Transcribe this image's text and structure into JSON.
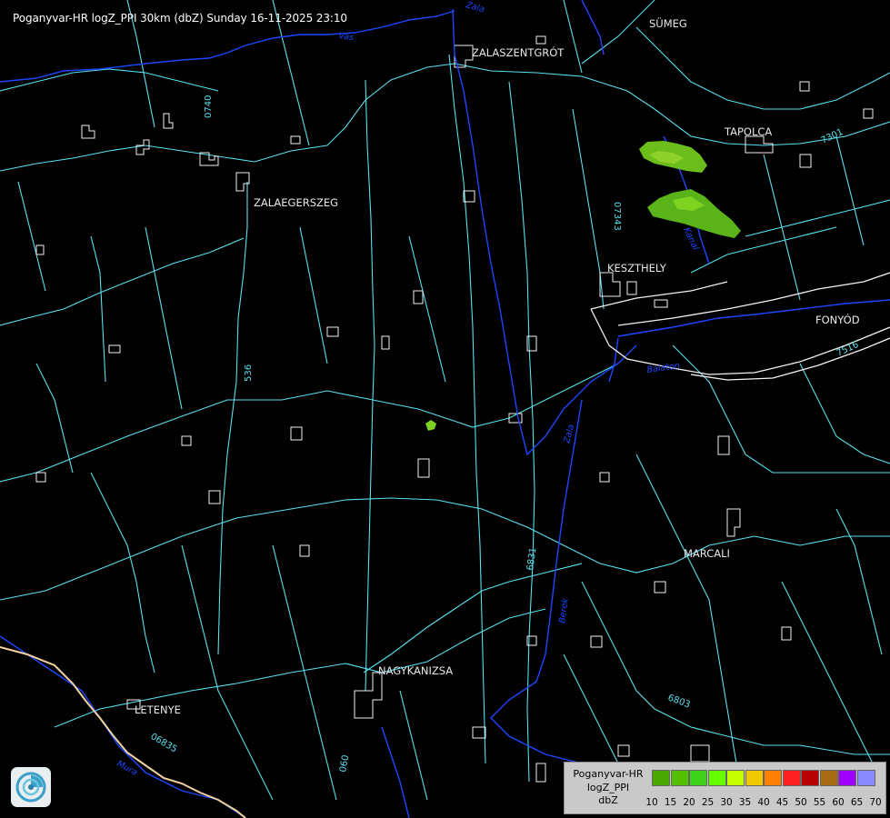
{
  "title": "Poganyvar-HR logZ_PPI 30km (dbZ) Sunday 16-11-2025 23:10",
  "towns": {
    "sumeg": "SÜMEG",
    "zalaszentgrot": "ZALASZENTGRÓT",
    "tapolca": "TAPOLCA",
    "zalaegerszeg": "ZALAEGERSZEG",
    "keszthely": "KESZTHELY",
    "fonyod": "FONYÓD",
    "marcali": "MARCALI",
    "nagykanizsa": "NAGYKANIZSA",
    "letenye": "LETENYE"
  },
  "road_labels": {
    "r0740": "0740",
    "r07343": "07343",
    "r7301": "7301",
    "r536": "536",
    "r6831": "6831",
    "r6803": "6803",
    "r06835": "06835",
    "r7516": "7516",
    "r060": "060"
  },
  "river_labels": {
    "zala_upper": "Zala",
    "zala_lower": "Zala",
    "vas": "Vas",
    "kanal": "Kanal",
    "berek": "Berek",
    "mura": "Mura",
    "balaton": "Balaton",
    "kiskanal": "Kanal"
  },
  "legend": {
    "line1": "Poganyvar-HR",
    "line2": "logZ_PPI",
    "line3": "dbZ",
    "ticks": [
      "10",
      "15",
      "20",
      "25",
      "30",
      "35",
      "40",
      "45",
      "50",
      "55",
      "60",
      "65",
      "70"
    ],
    "colors": [
      "#4aa800",
      "#55c000",
      "#3ed11a",
      "#66ff00",
      "#c8ff00",
      "#f0c800",
      "#ff7f00",
      "#ff2020",
      "#b80000",
      "#a86a14",
      "#a000ff",
      "#8a8aff"
    ]
  },
  "colors": {
    "background": "#000000",
    "roads": "#5be0ee",
    "rivers": "#1e46ff",
    "border": "#f2d3a0",
    "echo_light": "#7ed321",
    "echo_dark": "#4caf1a"
  },
  "icons": {
    "logo": "radar-service-logo"
  }
}
